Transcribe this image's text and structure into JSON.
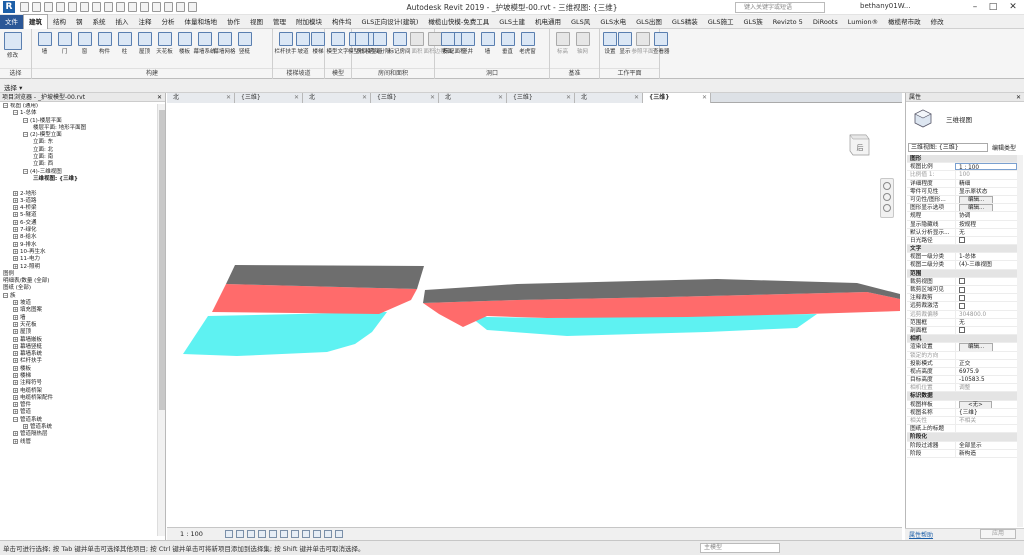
{
  "app": {
    "title": "Autodesk Revit 2019 - _护坡模型-00.rvt - 三维视图: {三维}",
    "search_placeholder": "键入关键字或短语",
    "user": "bethany01W..."
  },
  "ribbon_tabs": [
    "文件",
    "建筑",
    "结构",
    "钢",
    "系统",
    "插入",
    "注释",
    "分析",
    "体量和场地",
    "协作",
    "视图",
    "管理",
    "附加模块",
    "构件坞",
    "GLS正向设计(建筑)",
    "橄榄山快模-免费工具",
    "GLS土建",
    "机电通用",
    "GLS风",
    "GLS水电",
    "GLS出图",
    "GLS精装",
    "GLS施工",
    "GLS族",
    "Revizto 5",
    "DiRoots",
    "Lumion®",
    "橄榄帮市政",
    "修改"
  ],
  "ribbon_groups": [
    {
      "label": "选择",
      "tools": [
        "修改"
      ]
    },
    {
      "label": "构建",
      "tools": [
        "墙",
        "门",
        "窗",
        "构件",
        "柱",
        "屋顶",
        "天花板",
        "楼板",
        "幕墙系统",
        "幕墙网格",
        "竖梃"
      ]
    },
    {
      "label": "楼梯坡道",
      "tools": [
        "栏杆扶手",
        "坡道",
        "楼梯"
      ]
    },
    {
      "label": "模型",
      "tools": [
        "模型文字",
        "模型线",
        "模型组"
      ]
    },
    {
      "label": "房间和面积",
      "tools": [
        "房间",
        "房间分隔",
        "标记房间",
        "面积",
        "面积边界",
        "标记面积"
      ]
    },
    {
      "label": "洞口",
      "tools": [
        "按面",
        "竖井",
        "墙",
        "垂直",
        "老虎窗"
      ]
    },
    {
      "label": "基准",
      "tools": [
        "标高",
        "轴网"
      ]
    },
    {
      "label": "工作平面",
      "tools": [
        "设置",
        "显示",
        "参照平面",
        "查看器"
      ]
    }
  ],
  "select_label": "选择 ▾",
  "browser": {
    "title": "项目浏览器 - _护坡模型-00.rvt",
    "nodes": [
      {
        "t": "视图 (通用)",
        "d": 0,
        "tog": "−"
      },
      {
        "t": "1-总体",
        "d": 1,
        "tog": "−"
      },
      {
        "t": "(1)-楼层平面",
        "d": 2,
        "tog": "−"
      },
      {
        "t": "楼层平面: 地形平面图",
        "d": 3
      },
      {
        "t": "(2)-模型立面",
        "d": 2,
        "tog": "−"
      },
      {
        "t": "立面: 东",
        "d": 3
      },
      {
        "t": "立面: 北",
        "d": 3
      },
      {
        "t": "立面: 南",
        "d": 3
      },
      {
        "t": "立面: 西",
        "d": 3
      },
      {
        "t": "(4)-三维视图",
        "d": 2,
        "tog": "−"
      },
      {
        "t": "三维视图: {三维}",
        "d": 3,
        "sel": true
      },
      {
        "t": "",
        "d": 0
      },
      {
        "t": "2-地形",
        "d": 1,
        "tog": "+"
      },
      {
        "t": "3-道路",
        "d": 1,
        "tog": "+"
      },
      {
        "t": "4-桥梁",
        "d": 1,
        "tog": "+"
      },
      {
        "t": "5-隧道",
        "d": 1,
        "tog": "+"
      },
      {
        "t": "6-交通",
        "d": 1,
        "tog": "+"
      },
      {
        "t": "7-绿化",
        "d": 1,
        "tog": "+"
      },
      {
        "t": "8-给水",
        "d": 1,
        "tog": "+"
      },
      {
        "t": "9-排水",
        "d": 1,
        "tog": "+"
      },
      {
        "t": "10-再生水",
        "d": 1,
        "tog": "+"
      },
      {
        "t": "11-电力",
        "d": 1,
        "tog": "+"
      },
      {
        "t": "12-照明",
        "d": 1,
        "tog": "+"
      },
      {
        "t": "图例",
        "d": 0
      },
      {
        "t": "明细表/数量 (全部)",
        "d": 0
      },
      {
        "t": "图纸 (全部)",
        "d": 0
      },
      {
        "t": "族",
        "d": 0,
        "tog": "−"
      },
      {
        "t": "坡道",
        "d": 1,
        "tog": "+"
      },
      {
        "t": "填充图案",
        "d": 1,
        "tog": "+"
      },
      {
        "t": "墙",
        "d": 1,
        "tog": "+"
      },
      {
        "t": "天花板",
        "d": 1,
        "tog": "+"
      },
      {
        "t": "屋顶",
        "d": 1,
        "tog": "+"
      },
      {
        "t": "幕墙嵌板",
        "d": 1,
        "tog": "+"
      },
      {
        "t": "幕墙竖梃",
        "d": 1,
        "tog": "+"
      },
      {
        "t": "幕墙系统",
        "d": 1,
        "tog": "+"
      },
      {
        "t": "栏杆扶手",
        "d": 1,
        "tog": "+"
      },
      {
        "t": "楼板",
        "d": 1,
        "tog": "+"
      },
      {
        "t": "楼梯",
        "d": 1,
        "tog": "+"
      },
      {
        "t": "注释符号",
        "d": 1,
        "tog": "+"
      },
      {
        "t": "电缆桥架",
        "d": 1,
        "tog": "+"
      },
      {
        "t": "电缆桥架配件",
        "d": 1,
        "tog": "+"
      },
      {
        "t": "管件",
        "d": 1,
        "tog": "+"
      },
      {
        "t": "管道",
        "d": 1,
        "tog": "+"
      },
      {
        "t": "管道系统",
        "d": 1,
        "tog": "−"
      },
      {
        "t": "管道系统",
        "d": 2,
        "tog": "+"
      },
      {
        "t": "管道隔热层",
        "d": 1,
        "tog": "+"
      },
      {
        "t": "线管",
        "d": 1,
        "tog": "+"
      }
    ]
  },
  "view_tabs": [
    {
      "label": "北",
      "active": false
    },
    {
      "label": "{三维}",
      "active": false
    },
    {
      "label": "北",
      "active": false
    },
    {
      "label": "{三维}",
      "active": false
    },
    {
      "label": "北",
      "active": false
    },
    {
      "label": "{三维}",
      "active": false
    },
    {
      "label": "北",
      "active": false
    },
    {
      "label": "{三维}",
      "active": true
    }
  ],
  "viewcube_label": "后",
  "view_control": {
    "scale": "1 : 100"
  },
  "status": {
    "text": "单击可进行选择; 按 Tab 键并单击可选择其他项目; 按 Ctrl 键并单击可将新项目添加到选择集; 按 Shift 键并单击可取消选择。",
    "workset": "主模型"
  },
  "properties": {
    "title": "属性",
    "type_name": "三维视图",
    "type_select": "三维视图: {三维}",
    "edit_type": "编辑类型",
    "rows": [
      {
        "cat": "图形"
      },
      {
        "k": "视图比例",
        "v": "1 : 100",
        "input": true
      },
      {
        "k": "比例值 1:",
        "v": "100",
        "dim": true
      },
      {
        "k": "详细程度",
        "v": "精细"
      },
      {
        "k": "零件可见性",
        "v": "显示原状态"
      },
      {
        "k": "可见性/图形...",
        "v": "编辑...",
        "btn": true
      },
      {
        "k": "图形显示选项",
        "v": "编辑...",
        "btn": true
      },
      {
        "k": "规程",
        "v": "协调"
      },
      {
        "k": "显示隐藏线",
        "v": "按规程"
      },
      {
        "k": "默认分析显示...",
        "v": "无"
      },
      {
        "k": "日光路径",
        "cb": true
      },
      {
        "cat": "文字"
      },
      {
        "k": "视图一级分类",
        "v": "1-总体"
      },
      {
        "k": "视图二级分类",
        "v": "(4)-三维视图"
      },
      {
        "cat": "范围"
      },
      {
        "k": "裁剪视图",
        "cb": true
      },
      {
        "k": "裁剪区域可见",
        "cb": true
      },
      {
        "k": "注释裁剪",
        "cb": true
      },
      {
        "k": "远剪裁激活",
        "cb": true
      },
      {
        "k": "远剪裁偏移",
        "v": "304800.0",
        "dim": true
      },
      {
        "k": "范围框",
        "v": "无"
      },
      {
        "k": "剖面框",
        "cb": true
      },
      {
        "cat": "相机"
      },
      {
        "k": "渲染设置",
        "v": "编辑...",
        "btn": true
      },
      {
        "k": "锁定的方向",
        "v": "",
        "dim": true
      },
      {
        "k": "投影模式",
        "v": "正交"
      },
      {
        "k": "视点高度",
        "v": "6975.9"
      },
      {
        "k": "目标高度",
        "v": "-10583.5"
      },
      {
        "k": "相机位置",
        "v": "调整",
        "dim": true
      },
      {
        "cat": "标识数据"
      },
      {
        "k": "视图样板",
        "v": "<无>",
        "btn": true
      },
      {
        "k": "视图名称",
        "v": "{三维}"
      },
      {
        "k": "相关性",
        "v": "不相关",
        "dim": true
      },
      {
        "k": "图纸上的标题",
        "v": ""
      },
      {
        "cat": "阶段化"
      },
      {
        "k": "阶段过滤器",
        "v": "全部显示"
      },
      {
        "k": "阶段",
        "v": "新构造"
      }
    ],
    "help": "属性帮助",
    "apply": "应用"
  },
  "colors": {
    "accent": "#2b5797",
    "slope_top": "#6e6e6e",
    "slope_mid": "#ff6b6b",
    "slope_water": "#5ef2f2"
  }
}
